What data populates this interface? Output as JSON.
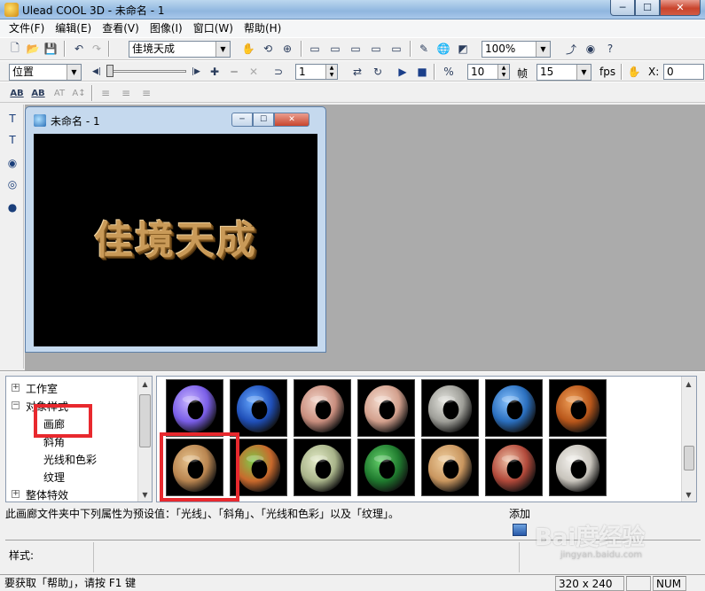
{
  "window": {
    "title": "Ulead COOL 3D - 未命名 - 1",
    "min_glyph": "─",
    "max_glyph": "☐",
    "close_glyph": "✕"
  },
  "menu": [
    "文件(F)",
    "编辑(E)",
    "查看(V)",
    "图像(I)",
    "窗口(W)",
    "帮助(H)"
  ],
  "toolbar1": {
    "text_combo": "佳境天成",
    "zoom_combo": "100%"
  },
  "toolbar2": {
    "mode_combo": "位置",
    "frame_value": "1",
    "frames_value": "10",
    "frames_label": "帧",
    "fps_value": "15",
    "fps_label": "fps",
    "x_label": "X:",
    "x_value": "0"
  },
  "toolbar3": {
    "font_ab1": "AB",
    "font_ab2": "AB",
    "font_at": "AT",
    "font_at2": "A↕"
  },
  "child_window": {
    "title": "未命名 - 1",
    "canvas_text": "佳境天成"
  },
  "tree": {
    "items": [
      {
        "label": "工作室",
        "expander": "+"
      },
      {
        "label": "对象样式",
        "expander": "−"
      },
      {
        "label": "画廊"
      },
      {
        "label": "斜角"
      },
      {
        "label": "光线和色彩"
      },
      {
        "label": "纹理"
      },
      {
        "label": "整体特效",
        "expander": "+"
      }
    ]
  },
  "gallery": {
    "thumbnails": [
      {
        "name": "purple-glow",
        "color": "#7a5ee8",
        "hi": "#c9b6ff"
      },
      {
        "name": "blue-swirl",
        "color": "#1f4fb8",
        "hi": "#66a8ff"
      },
      {
        "name": "pink-marble",
        "color": "#c98e7e",
        "hi": "#f2d4c8"
      },
      {
        "name": "rose-stone",
        "color": "#d3a08d",
        "hi": "#f5ddd0"
      },
      {
        "name": "gray-marble",
        "color": "#9e9e98",
        "hi": "#e6e6e0"
      },
      {
        "name": "blue-texture",
        "color": "#2a6fbf",
        "hi": "#8ac4ff"
      },
      {
        "name": "orange-wood",
        "color": "#b8561a",
        "hi": "#f0a15a"
      },
      {
        "name": "wicker",
        "color": "#b98550",
        "hi": "#e8c48e"
      },
      {
        "name": "rainbow-weave",
        "color": "#c9692c",
        "hi": "#7ec94a"
      },
      {
        "name": "pale-green",
        "color": "#a9b48a",
        "hi": "#e4ecc8"
      },
      {
        "name": "green-marble",
        "color": "#1f7a2e",
        "hi": "#64d06a"
      },
      {
        "name": "tan-grain",
        "color": "#c9965f",
        "hi": "#f0cf9f"
      },
      {
        "name": "red-granite",
        "color": "#b2493a",
        "hi": "#f0c3a8"
      },
      {
        "name": "white-granite",
        "color": "#c8c4bc",
        "hi": "#f4f2ee"
      }
    ]
  },
  "description": "此画廊文件夹中下列属性为预设值：「光线」、「斜角」、「光线和色彩」以及「纹理」。",
  "add_label": "添加",
  "props_label": "样式:",
  "status": {
    "help_text": "要获取「帮助」，请按 F1 键",
    "size": "320 x 240",
    "num": "NUM"
  },
  "watermark": {
    "text": "Bai度经验",
    "sub": "jingyan.baidu.com"
  },
  "colors": {
    "highlight": "#e8292e",
    "canvas_bg": "#000000",
    "workspace_bg": "#ababab"
  }
}
